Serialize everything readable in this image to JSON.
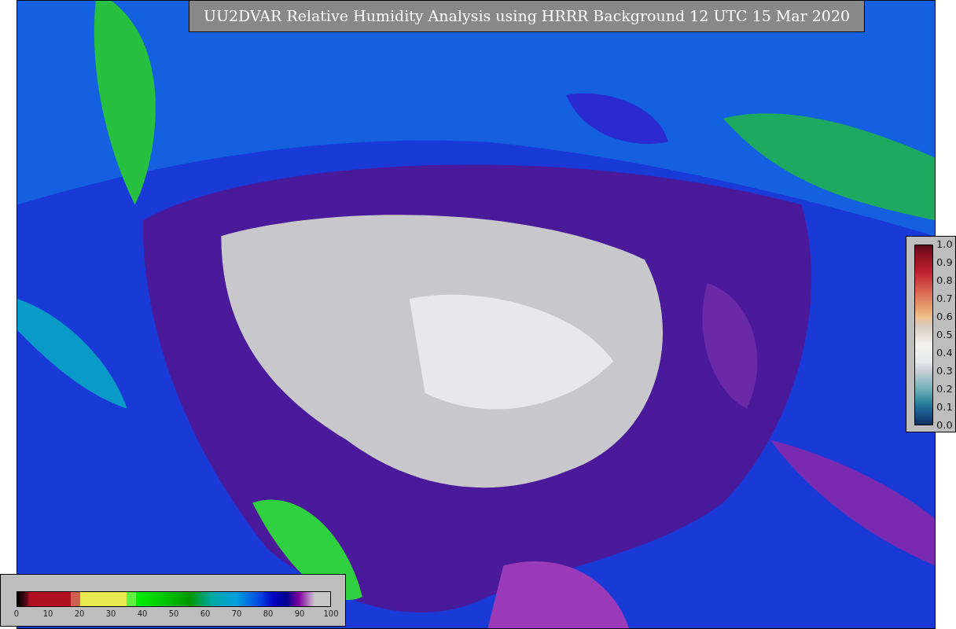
{
  "title": "UU2DVAR Relative Humidity Analysis using HRRR Background 12 UTC 15 Mar 2020",
  "humidity_scale": {
    "ticks": [
      "0",
      "10",
      "20",
      "30",
      "40",
      "50",
      "60",
      "70",
      "80",
      "90",
      "100"
    ]
  },
  "ratio_scale": {
    "ticks": [
      "1.0",
      "0.9",
      "0.8",
      "0.7",
      "0.6",
      "0.5",
      "0.4",
      "0.3",
      "0.2",
      "0.1",
      "0.0"
    ]
  }
}
